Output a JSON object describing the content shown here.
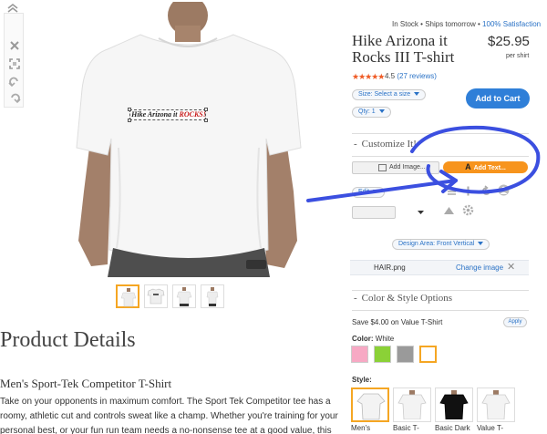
{
  "toolbar": {
    "tools": [
      "collapse-icon",
      "close-icon",
      "fit-icon",
      "undo-icon",
      "redo-icon"
    ]
  },
  "canvas": {
    "design_text_part1": "Hike Arizona it ",
    "design_text_part2": "ROCKS!"
  },
  "thumbnails": {
    "count": 4,
    "selected_index": 0
  },
  "details": {
    "title": "Product Details",
    "subtitle": "Men's Sport-Tek Competitor T-Shirt",
    "description": "Take on your opponents in maximum comfort. The Sport Tek Competitor tee has a roomy, athletic cut and controls sweat like a champ. Whether you're training for your personal best, or your fun run team needs a no-nonsense tee at a good value, this lightweight shirt delivers."
  },
  "product": {
    "status_stock": "In Stock",
    "status_sep1": "•",
    "status_ships": "Ships tomorrow",
    "status_sep2": "•",
    "status_satisfaction": "100% Satisfaction",
    "title": "Hike Arizona it Rocks III T-shirt",
    "price": "$25.95",
    "price_unit": "per shirt",
    "stars": "★★★★★",
    "rating_value": "4.5",
    "rating_reviews": "(27 reviews)",
    "size_label": "Size: Select a size",
    "qty_label": "Qty: 1",
    "add_to_cart": "Add to Cart"
  },
  "customize": {
    "dash": "-",
    "heading": "Customize It!",
    "add_image": "Add Image...",
    "add_text_glyph": "A",
    "add_text": "Add Text...",
    "edit": "Edit",
    "design_area": "Design Area: Front Vertical",
    "file_name": "HAIR.png",
    "change_image": "Change image",
    "close": "✕"
  },
  "color_style": {
    "dash": "-",
    "heading": "Color & Style Options",
    "save_text": "Save $4.00 on Value T-Shirt",
    "apply": "Apply",
    "color_label_prefix": "Color:",
    "color_value": "White",
    "swatches": [
      "#f7a9c4",
      "#8bd137",
      "#9a9a9a",
      "#ffffff"
    ],
    "selected_swatch": 3,
    "style_label": "Style:",
    "styles": [
      "Men's",
      "Basic T-",
      "Basic Dark",
      "Value T-"
    ],
    "selected_style": 0
  },
  "colors": {
    "accent_orange": "#f7941d",
    "link_blue": "#2a72c6",
    "cart_blue": "#2f7fd8",
    "annotation_blue": "#3b4fe0"
  }
}
